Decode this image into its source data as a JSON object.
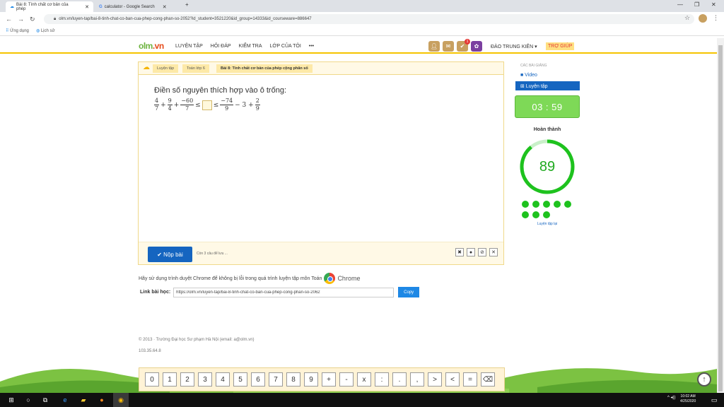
{
  "browser": {
    "tabs": [
      {
        "title": "Bài 8: Tính chất cơ bản của phép",
        "active": true
      },
      {
        "title": "calculator - Google Search",
        "active": false
      }
    ],
    "new_tab": "+",
    "url": "olm.vn/luyen-tap/bai-8-tinh-chat-co-ban-cua-phep-cong-phan-so-2052?id_student=3521220&id_group=14333&id_courseware=886647",
    "bookmarks": [
      "Ứng dụng",
      "Lịch sử"
    ]
  },
  "site": {
    "logo_main": "olm",
    "logo_suffix": ".vn",
    "menu": [
      "LUYỆN TẬP",
      "HỎI ĐÁP",
      "KIỂM TRA",
      "LỚP CỦA TÔI",
      "•••"
    ],
    "notification_count": "1",
    "user_name": "ĐÀO TRUNG KIÊN ▾",
    "help": "TRỢ GIÚP"
  },
  "breadcrumb": [
    "Luyện tập",
    "Toán lớp 6",
    "Bài 8: Tính chất cơ bản của phép cộng phân số"
  ],
  "exercise": {
    "question": "Điền số nguyên thích hợp vào ô trống:",
    "fractions": [
      {
        "num": "4",
        "den": "7"
      },
      {
        "num": "9",
        "den": "4"
      },
      {
        "num": "−60",
        "den": "7"
      },
      {
        "num": "−74",
        "den": "9"
      },
      {
        "num": "2",
        "den": "9"
      }
    ],
    "ops": [
      "+",
      "+",
      "≤",
      "≤",
      "− 3 +"
    ],
    "submit_label": "✔ Nộp bài",
    "remaining": "Còn 3 câu để lưu ...",
    "tools": [
      "✖",
      "●",
      "⊘",
      "✕"
    ]
  },
  "notes": {
    "chrome_note": "Hãy sử dụng trình duyệt Chrome để không bị lỗi trong quá trình luyện tập môn Toán",
    "chrome_word": "Chrome",
    "link_label": "Link bài học:",
    "link_value": "https://olm.vn/luyen-tap/bai-8-tinh-chat-co-ban-cua-phep-cong-phan-so-2062",
    "copy_label": "Copy",
    "copyright": "© 2013 · Trường Đại học Sư phạm Hà Nội (email: a@olm.vn)",
    "ip": "103.35.64.8"
  },
  "sidebar": {
    "section_title": "CÁC BÀI GIẢNG",
    "video": "■ Video",
    "practice": "⊞ Luyện tập",
    "timer": "03 : 59",
    "done_title": "Hoàn thành",
    "score": "89",
    "score_fraction": 0.89,
    "dot_count": 8,
    "redo": "Luyện tập lại"
  },
  "keypad": [
    "0",
    "1",
    "2",
    "3",
    "4",
    "5",
    "6",
    "7",
    "8",
    "9",
    "+",
    "-",
    "x",
    ":",
    ".",
    ",",
    ">",
    "<",
    "=",
    "⌫"
  ],
  "taskbar": {
    "time": "10:02 AM",
    "date": "4/25/2020"
  },
  "colors": {
    "brand_green": "#6db33f",
    "accent_blue": "#1565c0",
    "timer_green": "#7ed957",
    "score_green": "#1ec21e",
    "header_yellow": "#f5c400"
  }
}
